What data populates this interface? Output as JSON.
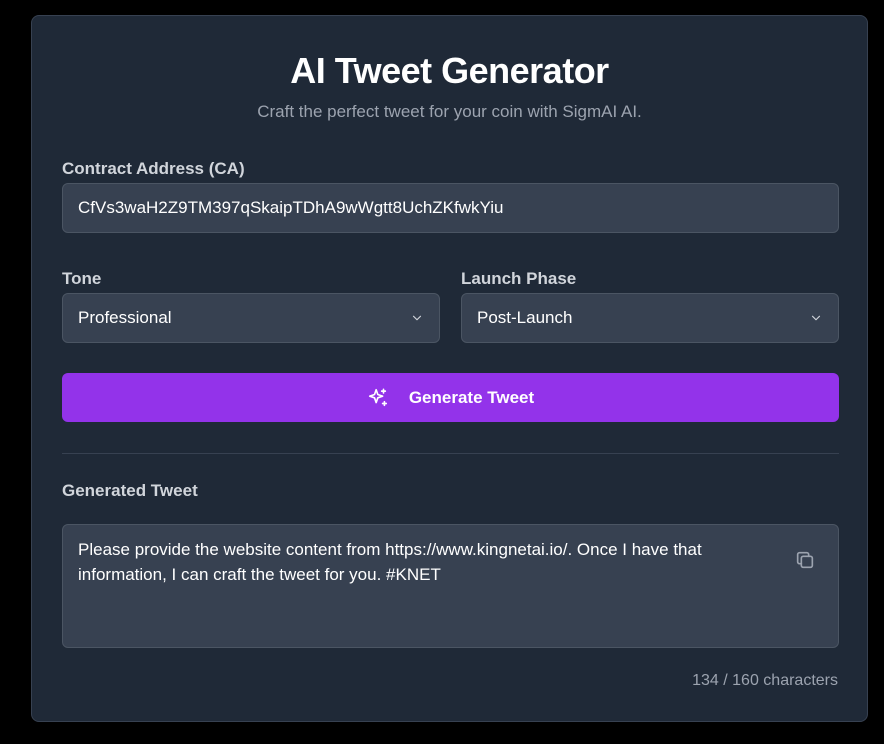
{
  "header": {
    "title": "AI Tweet Generator",
    "subtitle": "Craft the perfect tweet for your coin with SigmAI AI."
  },
  "form": {
    "contract_address": {
      "label": "Contract Address (CA)",
      "value": "CfVs3waH2Z9TM397qSkaipTDhA9wWgtt8UchZKfwkYiu"
    },
    "tone": {
      "label": "Tone",
      "selected": "Professional"
    },
    "launch_phase": {
      "label": "Launch Phase",
      "selected": "Post-Launch"
    },
    "generate_button_label": "Generate Tweet"
  },
  "output": {
    "label": "Generated Tweet",
    "text": "Please provide the website content from https://www.kingnetai.io/.  Once I have that information, I can craft the tweet for you. #KNET",
    "char_count": "134 / 160 characters"
  },
  "icons": {
    "chevron": "chevron-down-icon",
    "sparkle": "sparkles-icon",
    "copy": "copy-icon"
  },
  "colors": {
    "background": "#000000",
    "card": "#1f2937",
    "field": "#374151",
    "accent": "#9333ea",
    "muted_text": "#9ca3af"
  }
}
